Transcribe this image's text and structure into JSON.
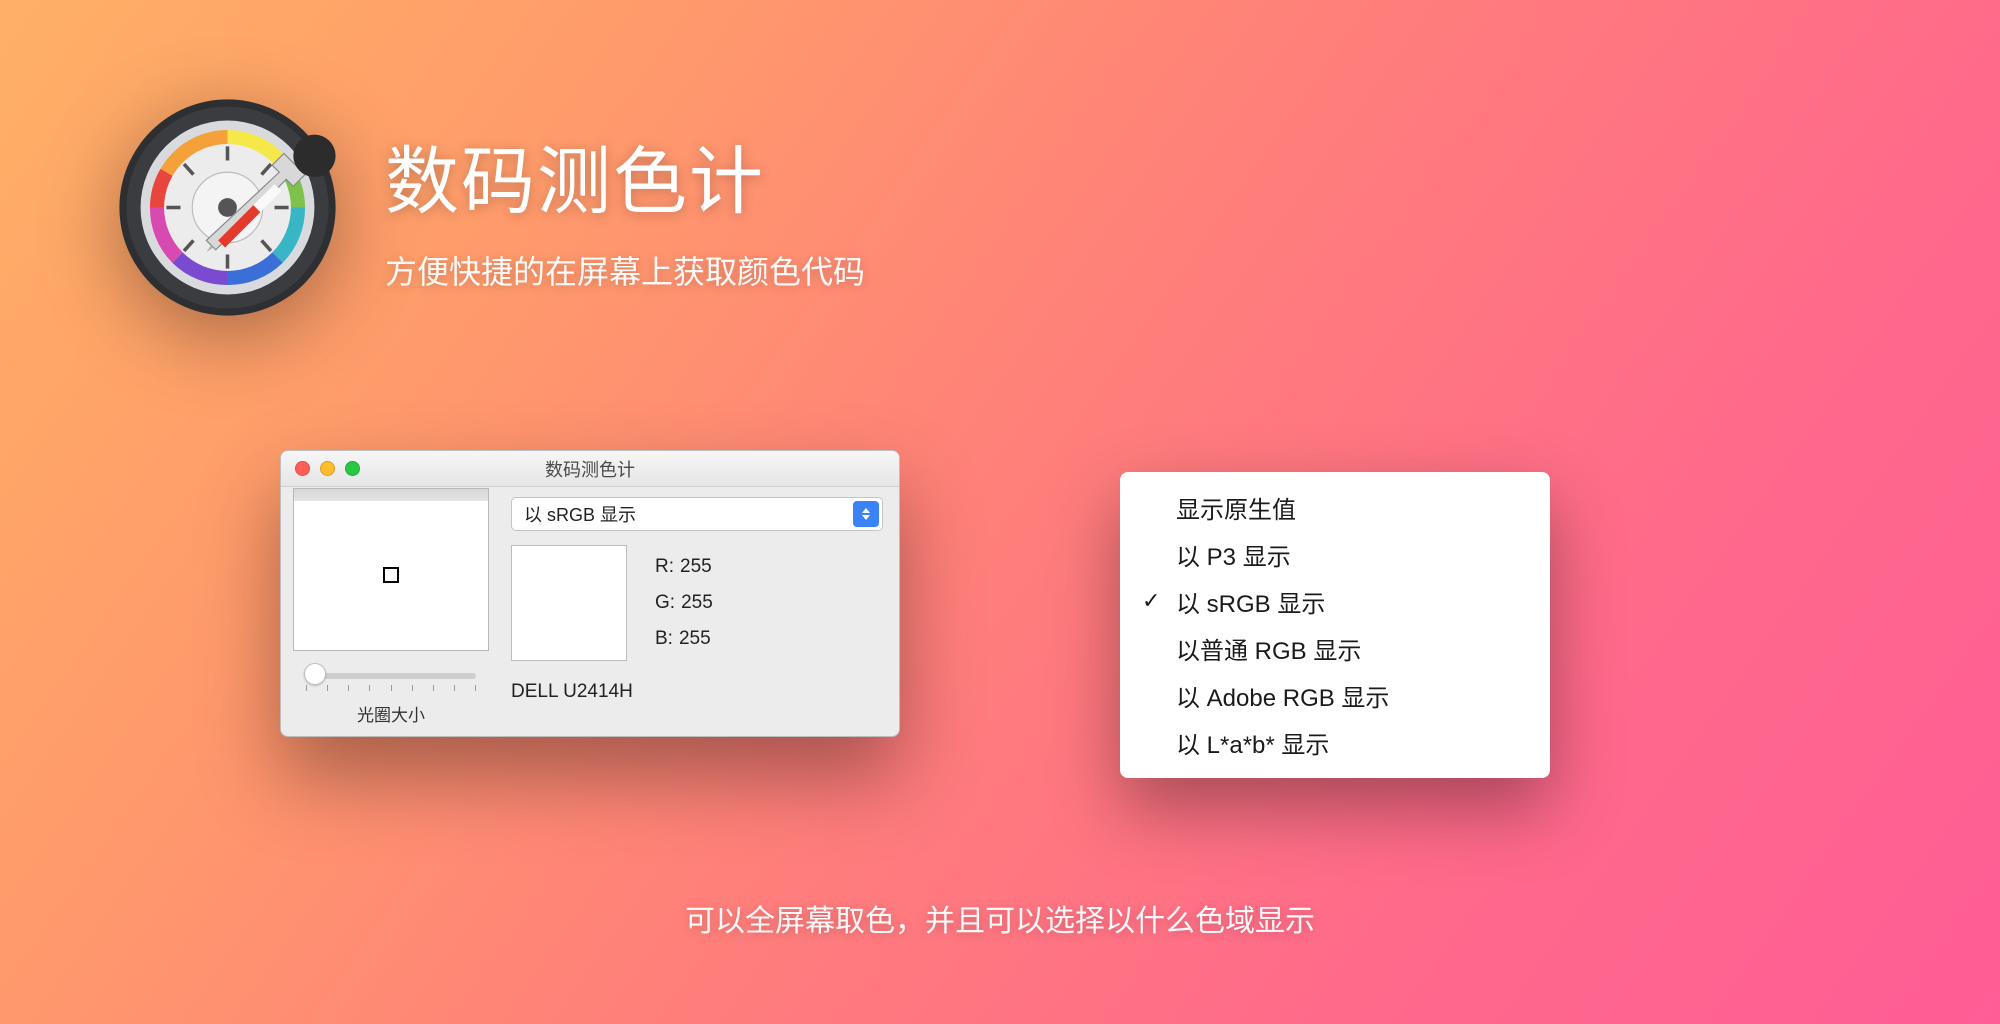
{
  "hero": {
    "title": "数码测色计",
    "subtitle": "方便快捷的在屏幕上获取颜色代码"
  },
  "window": {
    "title": "数码测色计",
    "combo_selected": "以 sRGB 显示",
    "r_label": "R:",
    "g_label": "G:",
    "b_label": "B:",
    "r_value": "255",
    "g_value": "255",
    "b_value": "255",
    "display_name": "DELL U2414H",
    "slider_label": "光圈大小"
  },
  "menu": {
    "items": [
      {
        "label": "显示原生值",
        "checked": false
      },
      {
        "label": "以 P3 显示",
        "checked": false
      },
      {
        "label": "以 sRGB 显示",
        "checked": true
      },
      {
        "label": "以普通 RGB 显示",
        "checked": false
      },
      {
        "label": "以 Adobe RGB 显示",
        "checked": false
      },
      {
        "label": "以 L*a*b* 显示",
        "checked": false
      }
    ]
  },
  "caption": "可以全屏幕取色，并且可以选择以什么色域显示"
}
